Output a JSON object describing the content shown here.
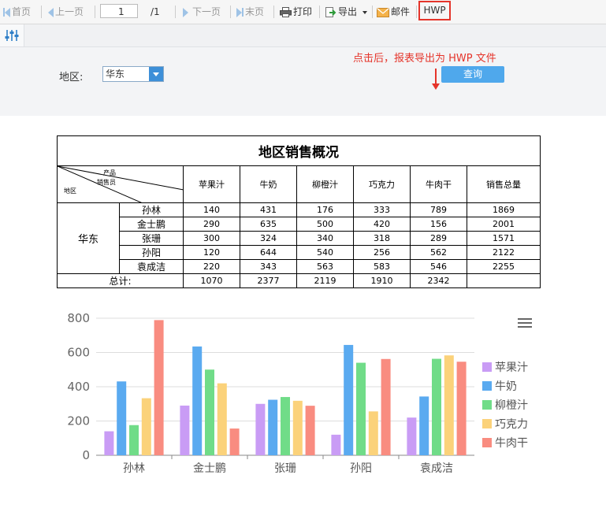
{
  "toolbar": {
    "first": "首页",
    "prev": "上一页",
    "page_value": "1",
    "page_total": "/1",
    "next": "下一页",
    "last": "末页",
    "print": "打印",
    "export": "导出",
    "mail": "邮件",
    "hwp": "HWP"
  },
  "annotation": "点击后，报表导出为 HWP 文件",
  "params": {
    "region_label": "地区:",
    "region_value": "华东",
    "query": "查询"
  },
  "report": {
    "title": "地区销售概况",
    "corner": {
      "product": "产品",
      "salesperson": "销售员",
      "region": "地区"
    },
    "columns": [
      "苹果汁",
      "牛奶",
      "柳橙汁",
      "巧克力",
      "牛肉干",
      "销售总量"
    ],
    "region": "华东",
    "rows": [
      {
        "name": "孙林",
        "values": [
          "140",
          "431",
          "176",
          "333",
          "789",
          "1869"
        ]
      },
      {
        "name": "金士鹏",
        "values": [
          "290",
          "635",
          "500",
          "420",
          "156",
          "2001"
        ]
      },
      {
        "name": "张珊",
        "values": [
          "300",
          "324",
          "340",
          "318",
          "289",
          "1571"
        ]
      },
      {
        "name": "孙阳",
        "values": [
          "120",
          "644",
          "540",
          "256",
          "562",
          "2122"
        ]
      },
      {
        "name": "袁成洁",
        "values": [
          "220",
          "343",
          "563",
          "583",
          "546",
          "2255"
        ]
      }
    ],
    "total_label": "总计:",
    "totals": [
      "1070",
      "2377",
      "2119",
      "1910",
      "2342",
      ""
    ]
  },
  "chart_data": {
    "type": "bar",
    "categories": [
      "孙林",
      "金士鹏",
      "张珊",
      "孙阳",
      "袁成洁"
    ],
    "series": [
      {
        "name": "苹果汁",
        "color": "#c99cf5",
        "values": [
          140,
          290,
          300,
          120,
          220
        ]
      },
      {
        "name": "牛奶",
        "color": "#5aaaf0",
        "values": [
          431,
          635,
          324,
          644,
          343
        ]
      },
      {
        "name": "柳橙汁",
        "color": "#70dc88",
        "values": [
          176,
          500,
          340,
          540,
          563
        ]
      },
      {
        "name": "巧克力",
        "color": "#fbd27a",
        "values": [
          333,
          420,
          318,
          256,
          583
        ]
      },
      {
        "name": "牛肉干",
        "color": "#f98c80",
        "values": [
          789,
          156,
          289,
          562,
          546
        ]
      }
    ],
    "yticks": [
      0,
      200,
      400,
      600,
      800
    ],
    "ylim": [
      0,
      800
    ],
    "grid": true,
    "legend": "right"
  }
}
